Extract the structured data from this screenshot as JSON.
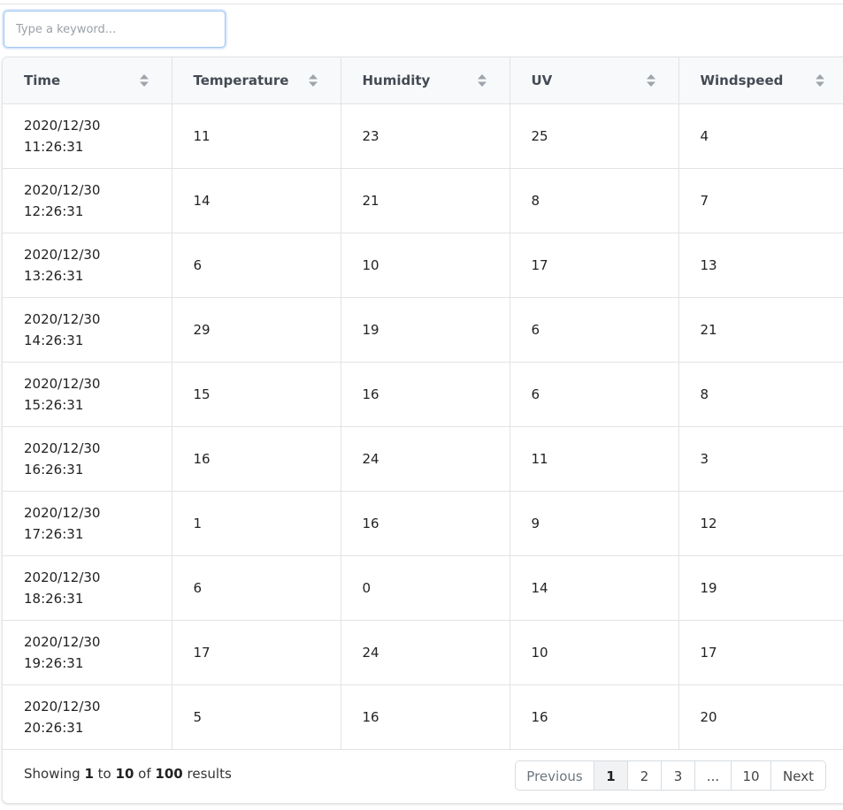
{
  "search": {
    "placeholder": "Type a keyword..."
  },
  "table": {
    "columns": [
      "Time",
      "Temperature",
      "Humidity",
      "UV",
      "Windspeed"
    ],
    "rows": [
      {
        "date": "2020/12/30",
        "time": "11:26:31",
        "temperature": "11",
        "humidity": "23",
        "uv": "25",
        "windspeed": "4"
      },
      {
        "date": "2020/12/30",
        "time": "12:26:31",
        "temperature": "14",
        "humidity": "21",
        "uv": "8",
        "windspeed": "7"
      },
      {
        "date": "2020/12/30",
        "time": "13:26:31",
        "temperature": "6",
        "humidity": "10",
        "uv": "17",
        "windspeed": "13"
      },
      {
        "date": "2020/12/30",
        "time": "14:26:31",
        "temperature": "29",
        "humidity": "19",
        "uv": "6",
        "windspeed": "21"
      },
      {
        "date": "2020/12/30",
        "time": "15:26:31",
        "temperature": "15",
        "humidity": "16",
        "uv": "6",
        "windspeed": "8"
      },
      {
        "date": "2020/12/30",
        "time": "16:26:31",
        "temperature": "16",
        "humidity": "24",
        "uv": "11",
        "windspeed": "3"
      },
      {
        "date": "2020/12/30",
        "time": "17:26:31",
        "temperature": "1",
        "humidity": "16",
        "uv": "9",
        "windspeed": "12"
      },
      {
        "date": "2020/12/30",
        "time": "18:26:31",
        "temperature": "6",
        "humidity": "0",
        "uv": "14",
        "windspeed": "19"
      },
      {
        "date": "2020/12/30",
        "time": "19:26:31",
        "temperature": "17",
        "humidity": "24",
        "uv": "10",
        "windspeed": "17"
      },
      {
        "date": "2020/12/30",
        "time": "20:26:31",
        "temperature": "5",
        "humidity": "16",
        "uv": "16",
        "windspeed": "20"
      }
    ]
  },
  "summary": {
    "prefix": "Showing",
    "from": "1",
    "to_word": "to",
    "to": "10",
    "of_word": "of",
    "total": "100",
    "suffix": "results"
  },
  "pagination": {
    "previous": "Previous",
    "pages": [
      "1",
      "2",
      "3",
      "...",
      "10"
    ],
    "active_page": "1",
    "next": "Next"
  },
  "colors": {
    "border": "#e3e3e3",
    "header_bg": "#f8f9fa",
    "input_focus": "#9ec5f0",
    "active_page_bg": "#f1f2f4"
  },
  "icons": {
    "sort": "sort-icon"
  }
}
